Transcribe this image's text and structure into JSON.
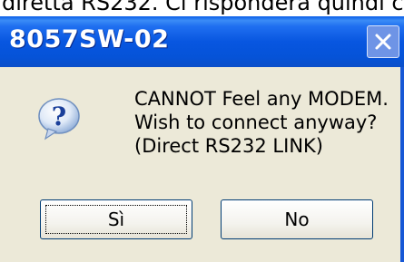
{
  "background_text": "diretta RS232. Ci risponderà quindi c",
  "window": {
    "title": "8057SW-02"
  },
  "message": {
    "lines": [
      "CANNOT Feel any MODEM.",
      "Wish to connect anyway?",
      "(Direct RS232 LINK)"
    ],
    "icon": "question-icon"
  },
  "buttons": {
    "yes_label": "Sì",
    "no_label": "No"
  },
  "colors": {
    "titlebar": "#0856e0",
    "dialog_bg": "#ece9d8",
    "close_button": "#6e94e6"
  }
}
